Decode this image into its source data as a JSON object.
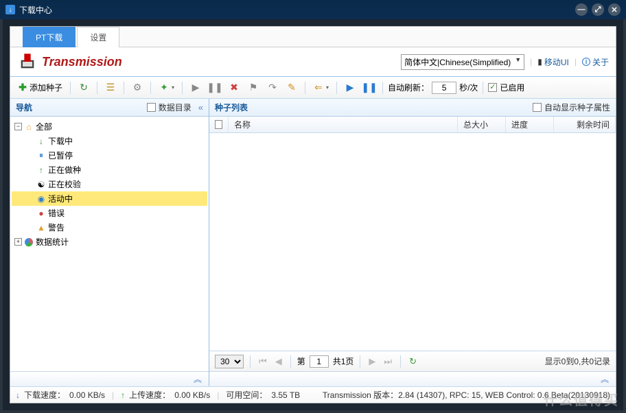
{
  "window": {
    "title": "下载中心"
  },
  "tabs": {
    "pt": "PT下载",
    "settings": "设置"
  },
  "brand": {
    "name": "Transmission"
  },
  "header_right": {
    "language": "简体中文|Chinese(Simplified)",
    "mobile_ui": "移动UI",
    "about": "关于"
  },
  "toolbar": {
    "add_torrent": "添加种子",
    "auto_refresh_label": "自动刷新：",
    "auto_refresh_value": "5",
    "auto_refresh_unit": "秒/次",
    "enabled": "已启用"
  },
  "nav": {
    "title": "导航",
    "data_dir": "数据目录",
    "collapse": "«",
    "items": {
      "all": "全部",
      "downloading": "下载中",
      "paused": "已暂停",
      "seeding": "正在做种",
      "verifying": "正在校验",
      "active": "活动中",
      "error": "错误",
      "warning": "警告",
      "stats": "数据统计"
    }
  },
  "list": {
    "title": "种子列表",
    "auto_show_props": "自动显示种子属性",
    "columns": {
      "name": "名称",
      "total_size": "总大小",
      "progress": "进度",
      "remaining": "剩余时间"
    }
  },
  "pager": {
    "page_size": "30",
    "page_label_prefix": "第",
    "page_value": "1",
    "page_total": "共1页",
    "summary": "显示0到0,共0记录"
  },
  "status": {
    "down_label": "下载速度：",
    "down_value": "0.00 KB/s",
    "up_label": "上传速度：",
    "up_value": "0.00 KB/s",
    "free_space_label": "可用空间：",
    "free_space_value": "3.55 TB",
    "version": "Transmission 版本：2.84 (14307), RPC: 15, WEB Control: 0.6 Beta(20130918)"
  },
  "watermark": "什么值得买"
}
